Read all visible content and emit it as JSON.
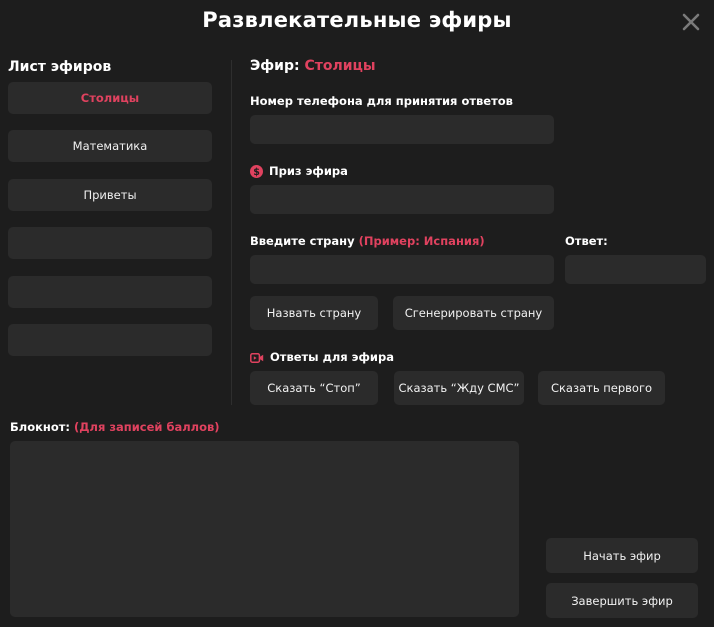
{
  "window": {
    "title": "Развлекательные эфиры"
  },
  "sidebar": {
    "heading": "Лист эфиров",
    "items": [
      {
        "label": "Столицы"
      },
      {
        "label": "Математика"
      },
      {
        "label": "Приветы"
      },
      {
        "label": ""
      },
      {
        "label": ""
      },
      {
        "label": ""
      }
    ]
  },
  "broadcast": {
    "heading_prefix": "Эфир:",
    "heading_name": "Столицы",
    "phone_label": "Номер телефона для принятия ответов",
    "phone_value": "",
    "prize_label": "Приз эфира",
    "prize_value": "",
    "country_label": "Введите страну",
    "country_hint": "(Пример: Испания)",
    "country_value": "",
    "answer_label": "Ответ:",
    "answer_value": "",
    "name_country_button": "Назвать страну",
    "generate_country_button": "Сгенерировать страну",
    "replies_label": "Ответы для эфира",
    "say_stop_button": "Сказать “Стоп”",
    "say_wait_sms_button": "Сказать “Жду СМС”",
    "say_first_button": "Сказать первого"
  },
  "notepad": {
    "label": "Блокнот:",
    "hint": "(Для записей баллов)",
    "value": ""
  },
  "actions": {
    "start_button": "Начать эфир",
    "finish_button": "Завершить эфир"
  },
  "colors": {
    "background": "#1d1d1d",
    "surface": "#2b2b2b",
    "accent": "#e0425f",
    "text": "#ffffff"
  },
  "icons": {
    "close": "close-icon",
    "prize": "dollar-coin-icon",
    "replies": "video-camera-icon"
  }
}
